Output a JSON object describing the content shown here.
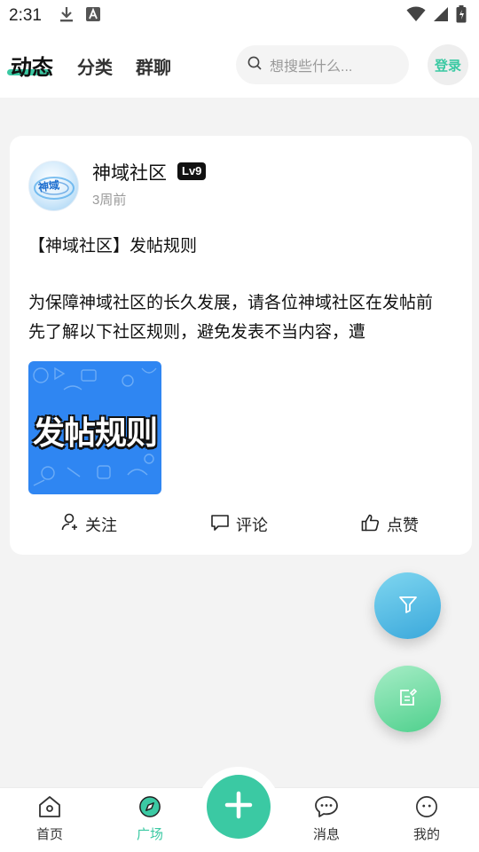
{
  "status_bar": {
    "time": "2:31"
  },
  "header": {
    "tabs": [
      {
        "label": "动态",
        "active": true
      },
      {
        "label": "分类",
        "active": false
      },
      {
        "label": "群聊",
        "active": false
      }
    ],
    "search_placeholder": "想搜些什么...",
    "login_label": "登录",
    "accent_color": "#3bc9a3"
  },
  "post": {
    "avatar_text": "神域",
    "author": "神域社区",
    "level": "Lv9",
    "time": "3周前",
    "title": "【神域社区】发帖规则",
    "body": "为保障神域社区的长久发展，请各位神域社区在发帖前先了解以下社区规则，避免发表不当内容，遭",
    "image_text": "发帖规则",
    "actions": {
      "follow": "关注",
      "comment": "评论",
      "like": "点赞"
    }
  },
  "bottom_nav": {
    "items": [
      {
        "label": "首页",
        "icon": "home-icon"
      },
      {
        "label": "广场",
        "icon": "compass-icon",
        "active": true
      },
      {
        "label": "消息",
        "icon": "chat-icon"
      },
      {
        "label": "我的",
        "icon": "profile-icon"
      }
    ]
  }
}
